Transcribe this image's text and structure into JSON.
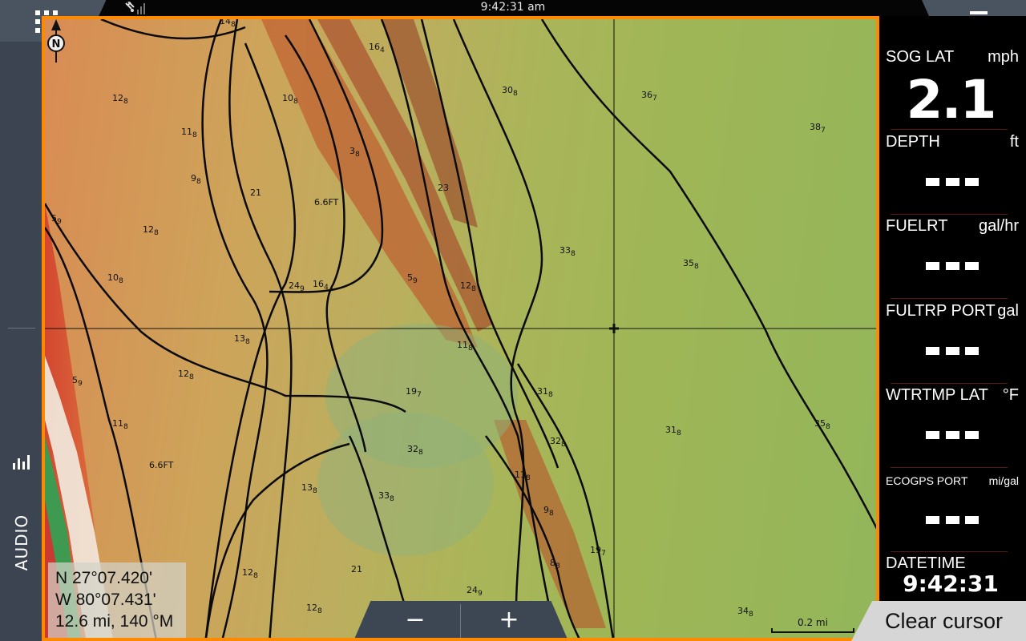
{
  "status_bar": {
    "time": "9:42:31 am",
    "gps_icon": "satellite-signal-icon"
  },
  "apps_button": {
    "icon": "apps-grid-icon"
  },
  "menu_button": {
    "icon": "hamburger-menu-icon"
  },
  "sidebar": {
    "audio_label": "AUDIO",
    "audio_icon": "equalizer-bars-icon"
  },
  "chart": {
    "compass_label": "N",
    "depths": [
      {
        "v": "14",
        "s": "8"
      },
      {
        "v": "16",
        "s": "4"
      },
      {
        "v": "12",
        "s": "8"
      },
      {
        "v": "10",
        "s": "8"
      },
      {
        "v": "11",
        "s": "8"
      },
      {
        "v": "9",
        "s": "8"
      },
      {
        "v": "21",
        "s": ""
      },
      {
        "v": "6.6FT",
        "s": ""
      },
      {
        "v": "3",
        "s": "8"
      },
      {
        "v": "23",
        "s": ""
      },
      {
        "v": "5",
        "s": "9"
      },
      {
        "v": "12",
        "s": "8"
      },
      {
        "v": "10",
        "s": "8"
      },
      {
        "v": "24",
        "s": "9"
      },
      {
        "v": "16",
        "s": "4"
      },
      {
        "v": "5",
        "s": "9"
      },
      {
        "v": "12",
        "s": "8"
      },
      {
        "v": "30",
        "s": "8"
      },
      {
        "v": "36",
        "s": "7"
      },
      {
        "v": "38",
        "s": "7"
      },
      {
        "v": "33",
        "s": "8"
      },
      {
        "v": "35",
        "s": "8"
      },
      {
        "v": "13",
        "s": "8"
      },
      {
        "v": "11",
        "s": "8"
      },
      {
        "v": "5",
        "s": "9"
      },
      {
        "v": "12",
        "s": "8"
      },
      {
        "v": "19",
        "s": "7"
      },
      {
        "v": "31",
        "s": "8"
      },
      {
        "v": "11",
        "s": "8"
      },
      {
        "v": "6.6FT",
        "s": ""
      },
      {
        "v": "32",
        "s": "8"
      },
      {
        "v": "32",
        "s": "8"
      },
      {
        "v": "31",
        "s": "8"
      },
      {
        "v": "35",
        "s": "8"
      },
      {
        "v": "13",
        "s": "8"
      },
      {
        "v": "33",
        "s": "8"
      },
      {
        "v": "11",
        "s": "8"
      },
      {
        "v": "9",
        "s": "8"
      },
      {
        "v": "12",
        "s": "8"
      },
      {
        "v": "21",
        "s": ""
      },
      {
        "v": "8",
        "s": "8"
      },
      {
        "v": "19",
        "s": "7"
      },
      {
        "v": "12",
        "s": "8"
      },
      {
        "v": "24",
        "s": "9"
      },
      {
        "v": "34",
        "s": "8"
      }
    ],
    "scale_label": "0.2 mi"
  },
  "cursor_info": {
    "lat": "N  27°07.420'",
    "lon": "W  80°07.431'",
    "range": "12.6 mi, 140 °M"
  },
  "zoom": {
    "out_label": "−",
    "in_label": "+"
  },
  "data_panel": [
    {
      "name": "SOG LAT",
      "unit": "mph",
      "value": "2.1"
    },
    {
      "name": "DEPTH",
      "unit": "ft",
      "value": "- - -"
    },
    {
      "name": "FUELRT",
      "unit": "gal/hr",
      "value": "- - -"
    },
    {
      "name": "FULTRP PORT",
      "unit": "gal",
      "value": "- - -"
    },
    {
      "name": "WTRTMP LAT",
      "unit": "°F",
      "value": "- - -"
    },
    {
      "name": "ECOGPS PORT",
      "unit": "mi/gal",
      "value": "- - -"
    },
    {
      "name": "DATETIME",
      "unit": "",
      "value": "9:42:31 am"
    }
  ],
  "clear_cursor_label": "Clear cursor",
  "colors": {
    "chart_border": "#ff8a00",
    "panel_bg": "#000000",
    "button_bg": "#4a5461"
  }
}
